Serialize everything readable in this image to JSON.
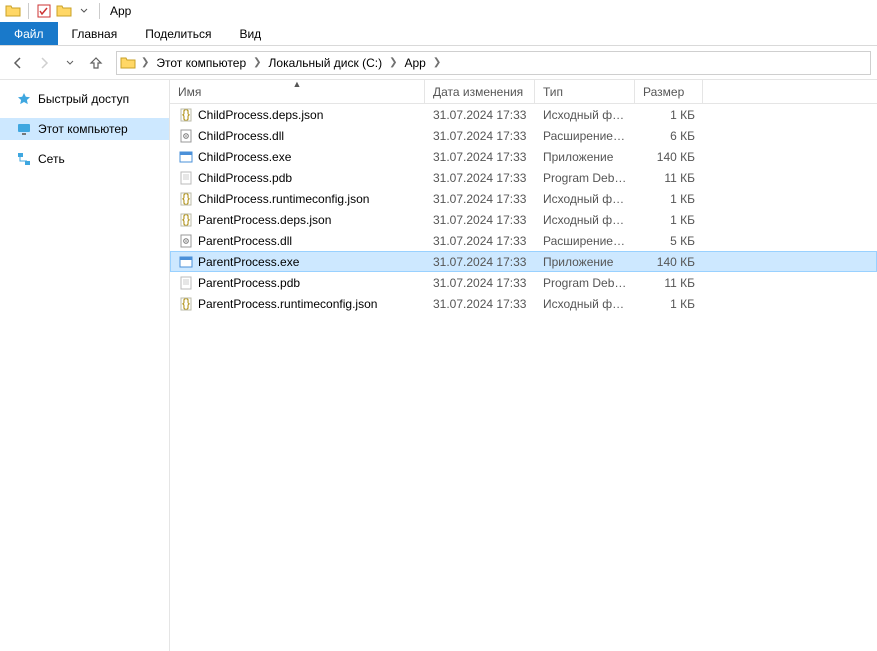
{
  "window": {
    "title": "App"
  },
  "ribbon": {
    "file": "Файл",
    "home": "Главная",
    "share": "Поделиться",
    "view": "Вид"
  },
  "breadcrumbs": [
    {
      "label": "Этот компьютер"
    },
    {
      "label": "Локальный диск (C:)"
    },
    {
      "label": "App"
    }
  ],
  "navpane": {
    "quick_access": "Быстрый доступ",
    "this_pc": "Этот компьютер",
    "network": "Сеть"
  },
  "columns": {
    "name": "Имя",
    "date": "Дата изменения",
    "type": "Тип",
    "size": "Размер"
  },
  "files": [
    {
      "name": "ChildProcess.deps.json",
      "date": "31.07.2024 17:33",
      "type": "Исходный файл…",
      "size": "1 КБ",
      "icon": "json",
      "selected": false
    },
    {
      "name": "ChildProcess.dll",
      "date": "31.07.2024 17:33",
      "type": "Расширение пр…",
      "size": "6 КБ",
      "icon": "dll",
      "selected": false
    },
    {
      "name": "ChildProcess.exe",
      "date": "31.07.2024 17:33",
      "type": "Приложение",
      "size": "140 КБ",
      "icon": "exe",
      "selected": false
    },
    {
      "name": "ChildProcess.pdb",
      "date": "31.07.2024 17:33",
      "type": "Program Debug …",
      "size": "11 КБ",
      "icon": "file",
      "selected": false
    },
    {
      "name": "ChildProcess.runtimeconfig.json",
      "date": "31.07.2024 17:33",
      "type": "Исходный файл…",
      "size": "1 КБ",
      "icon": "json",
      "selected": false
    },
    {
      "name": "ParentProcess.deps.json",
      "date": "31.07.2024 17:33",
      "type": "Исходный файл…",
      "size": "1 КБ",
      "icon": "json",
      "selected": false
    },
    {
      "name": "ParentProcess.dll",
      "date": "31.07.2024 17:33",
      "type": "Расширение пр…",
      "size": "5 КБ",
      "icon": "dll",
      "selected": false
    },
    {
      "name": "ParentProcess.exe",
      "date": "31.07.2024 17:33",
      "type": "Приложение",
      "size": "140 КБ",
      "icon": "exe",
      "selected": true
    },
    {
      "name": "ParentProcess.pdb",
      "date": "31.07.2024 17:33",
      "type": "Program Debug …",
      "size": "11 КБ",
      "icon": "file",
      "selected": false
    },
    {
      "name": "ParentProcess.runtimeconfig.json",
      "date": "31.07.2024 17:33",
      "type": "Исходный файл…",
      "size": "1 КБ",
      "icon": "json",
      "selected": false
    }
  ]
}
